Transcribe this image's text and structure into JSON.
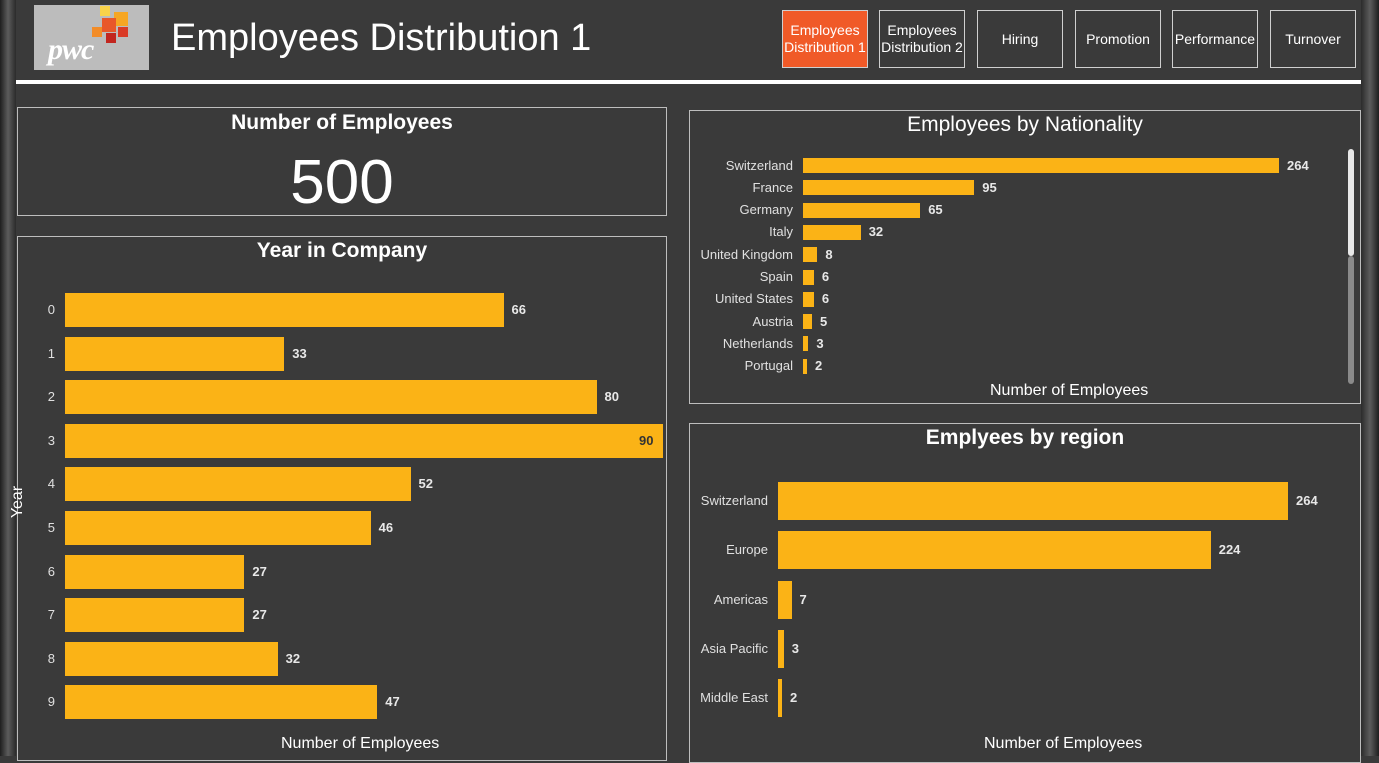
{
  "header": {
    "logo_text": "pwc",
    "title": "Employees Distribution 1",
    "nav": [
      {
        "label": "Employees Distribution 1",
        "active": true
      },
      {
        "label": "Employees Distribution 2",
        "active": false
      },
      {
        "label": "Hiring",
        "active": false
      },
      {
        "label": "Promotion",
        "active": false
      },
      {
        "label": "Performance",
        "active": false
      },
      {
        "label": "Turnover",
        "active": false
      }
    ]
  },
  "kpi": {
    "title": "Number of Employees",
    "value": "500"
  },
  "colors": {
    "bar": "#fbb316",
    "active_nav": "#f05a28",
    "background": "#3a3a3a"
  },
  "chart_data": [
    {
      "type": "bar",
      "orientation": "horizontal",
      "title": "Year in Company",
      "ylabel": "Year",
      "xlabel": "Number of Employees",
      "categories": [
        "0",
        "1",
        "2",
        "3",
        "4",
        "5",
        "6",
        "7",
        "8",
        "9"
      ],
      "values": [
        66,
        33,
        80,
        90,
        52,
        46,
        27,
        27,
        32,
        47
      ],
      "xlim": [
        0,
        90
      ],
      "grid": false
    },
    {
      "type": "bar",
      "orientation": "horizontal",
      "title": "Employees by Nationality",
      "xlabel": "Number of Employees",
      "categories": [
        "Switzerland",
        "France",
        "Germany",
        "Italy",
        "United Kingdom",
        "Spain",
        "United States",
        "Austria",
        "Netherlands",
        "Portugal"
      ],
      "values": [
        264,
        95,
        65,
        32,
        8,
        6,
        6,
        5,
        3,
        2
      ],
      "xlim": [
        0,
        264
      ],
      "grid": false
    },
    {
      "type": "bar",
      "orientation": "horizontal",
      "title": "Emplyees by region",
      "xlabel": "Number of Employees",
      "categories": [
        "Switzerland",
        "Europe",
        "Americas",
        "Asia Pacific",
        "Middle East"
      ],
      "values": [
        264,
        224,
        7,
        3,
        2
      ],
      "xlim": [
        0,
        264
      ],
      "grid": false
    }
  ]
}
